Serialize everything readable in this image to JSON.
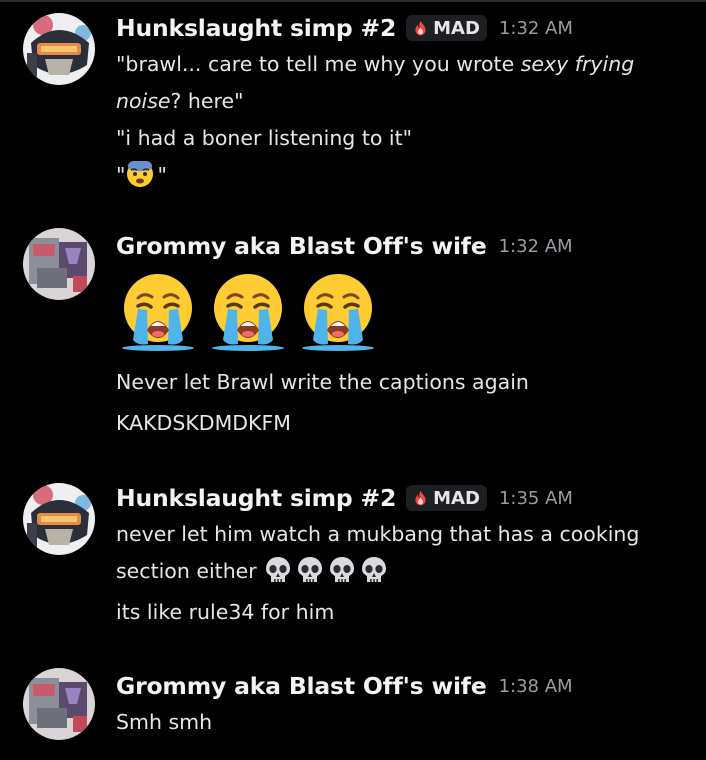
{
  "messages": [
    {
      "author": "Hunkslaught simp #2",
      "tag": "MAD",
      "tag_icon": "fire-icon",
      "time": "1:32 AM",
      "lines": [
        {
          "pre": "\"brawl... care to tell me why you wrote ",
          "em": "sexy frying"
        },
        {
          "em": "noise",
          "post": "? here\""
        },
        {
          "text": "\"i had a boner listening to it\""
        },
        {
          "pre": "\"",
          "emoji": "fearful-face-emoji",
          "post": "\""
        }
      ]
    },
    {
      "author": "Grommy aka Blast Off's wife",
      "time": "1:32 AM",
      "big_emoji": [
        "loudly-crying-face-emoji",
        "loudly-crying-face-emoji",
        "loudly-crying-face-emoji"
      ],
      "lines": [
        {
          "text": "Never let Brawl write the captions again"
        },
        {
          "text": "KAKDSKDMDKFM"
        }
      ]
    },
    {
      "author": "Hunkslaught simp #2",
      "tag": "MAD",
      "tag_icon": "fire-icon",
      "time": "1:35 AM",
      "lines": [
        {
          "text": "never let him watch a mukbang that has a cooking"
        },
        {
          "text": "section either",
          "emojis": [
            "skull-emoji",
            "skull-emoji",
            "skull-emoji",
            "skull-emoji"
          ]
        },
        {
          "text": "its like rule34 for him"
        }
      ]
    },
    {
      "author": "Grommy aka Blast Off's wife",
      "time": "1:38 AM",
      "lines": [
        {
          "text": "Smh smh"
        }
      ]
    }
  ],
  "colors": {
    "background": "#000000",
    "author_name": "#f2f3f5",
    "timestamp": "#9a9ca3",
    "tag_background": "#1e1f22",
    "fire": "#f04747"
  }
}
